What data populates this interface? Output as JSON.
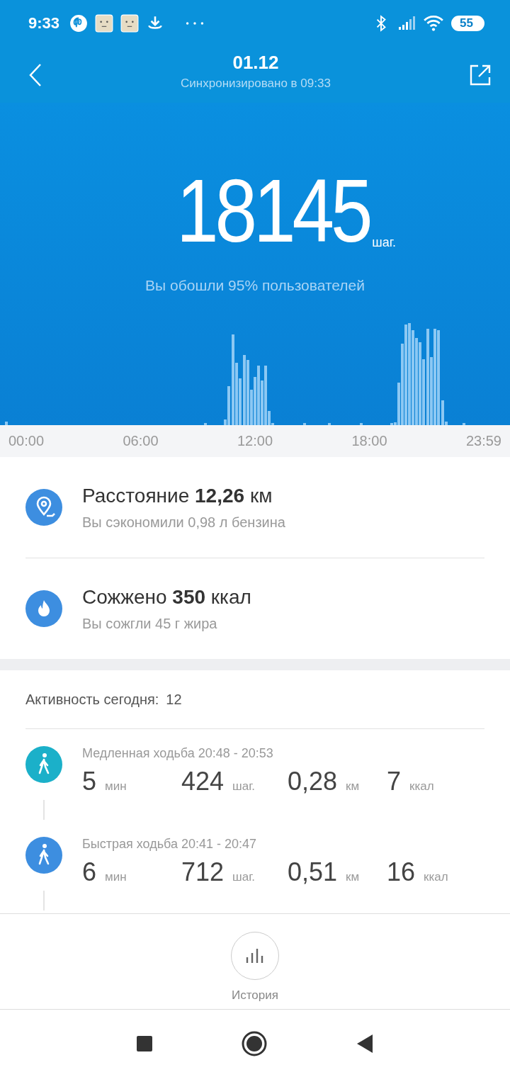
{
  "status_bar": {
    "time": "9:33",
    "battery": "55"
  },
  "header": {
    "title": "01.12",
    "subtitle": "Синхронизировано в 09:33"
  },
  "steps": {
    "value": "18145",
    "unit": "шаг.",
    "note": "Вы обошли 95% пользователей"
  },
  "time_labels": [
    "00:00",
    "06:00",
    "12:00",
    "18:00",
    "23:59"
  ],
  "summary": [
    {
      "kind": "distance",
      "title": "Расстояние **12,26** км",
      "subtitle": "Вы сэкономили 0,98 л бензина"
    },
    {
      "kind": "calories",
      "title": "Сожжено **350** ккал",
      "subtitle": "Вы сожгли 45 г жира"
    }
  ],
  "activity": {
    "label": "Активность сегодня:",
    "count": "12",
    "items": [
      {
        "title": "Медленная ходьба 20:48 - 20:53",
        "color": "#1bb0c9",
        "stats": [
          {
            "value": "5",
            "unit": "мин"
          },
          {
            "value": "424",
            "unit": "шаг."
          },
          {
            "value": "0,28",
            "unit": "км"
          },
          {
            "value": "7",
            "unit": "ккал"
          }
        ]
      },
      {
        "title": "Быстрая ходьба 20:41 - 20:47",
        "color": "#3d8ee0",
        "stats": [
          {
            "value": "6",
            "unit": "мин"
          },
          {
            "value": "712",
            "unit": "шаг."
          },
          {
            "value": "0,51",
            "unit": "км"
          },
          {
            "value": "16",
            "unit": "ккал"
          }
        ]
      }
    ]
  },
  "history": {
    "label": "История"
  }
}
